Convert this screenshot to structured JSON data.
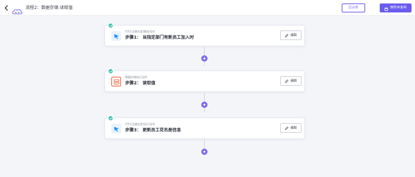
{
  "header": {
    "title": "流程2：数据存储-读取值",
    "share_label": "已分享",
    "save_label": "保存并发布"
  },
  "steps": [
    {
      "subtitle": "钉钉(当做应用)触发动作",
      "title": "步骤1： 当指定部门有新员工加入时",
      "edit_label": "编辑",
      "icon": "dingtalk-icon",
      "icon_color": "#1a8cff"
    },
    {
      "subtitle": "数据存储执行动作",
      "title": "步骤2： 读取值",
      "edit_label": "编辑",
      "icon": "data-storage-icon",
      "icon_color": "#f0623f"
    },
    {
      "subtitle": "钉钉(当做应用)执行动作",
      "title": "步骤3： 更新员工花名册信息",
      "edit_label": "编辑",
      "icon": "dingtalk-icon",
      "icon_color": "#1a8cff"
    }
  ],
  "colors": {
    "accent": "#6b5cf0",
    "success": "#2dbba6"
  }
}
